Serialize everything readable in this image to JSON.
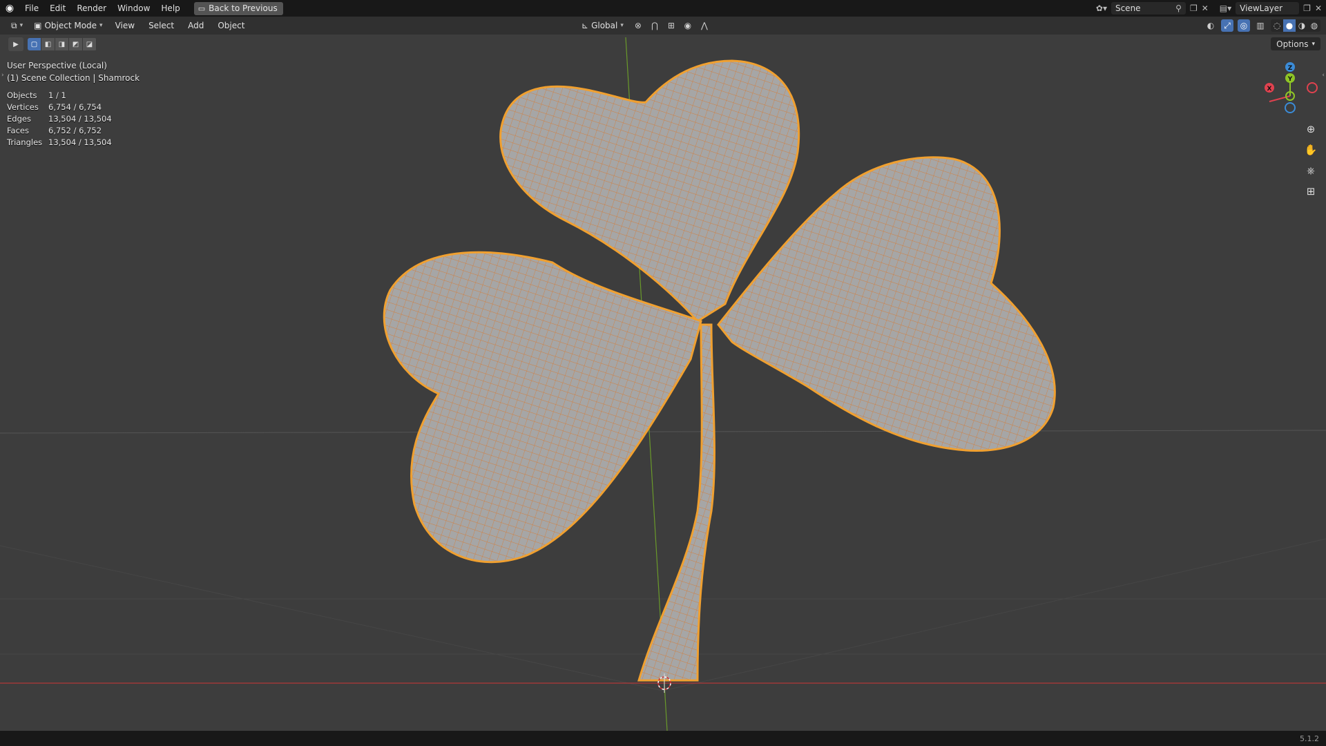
{
  "app": {
    "menu": [
      "File",
      "Edit",
      "Render",
      "Window",
      "Help"
    ],
    "back_button": "Back to Previous",
    "scene": "Scene",
    "view_layer": "ViewLayer",
    "version": "5.1.2"
  },
  "header": {
    "mode": "Object Mode",
    "menus": [
      "View",
      "Select",
      "Add",
      "Object"
    ],
    "transform_orientation": "Global",
    "options_label": "Options"
  },
  "overlay": {
    "view_name": "User Perspective (Local)",
    "collection": "(1) Scene Collection | Shamrock",
    "stats": [
      {
        "label": "Objects",
        "value": "1 / 1"
      },
      {
        "label": "Vertices",
        "value": "6,754 / 6,754"
      },
      {
        "label": "Edges",
        "value": "13,504 / 13,504"
      },
      {
        "label": "Faces",
        "value": "6,752 / 6,752"
      },
      {
        "label": "Triangles",
        "value": "13,504 / 13,504"
      }
    ]
  },
  "gizmo": {
    "x": "X",
    "y": "Y",
    "z": "Z",
    "colors": {
      "x": "#e0424f",
      "y": "#8fc526",
      "z": "#3b8cd8"
    }
  },
  "colors": {
    "background": "#3d3d3d",
    "mesh_fill": "#a3a3a3",
    "wire": "#d9782e",
    "outline": "#f0a030",
    "accent": "#4772b3"
  }
}
